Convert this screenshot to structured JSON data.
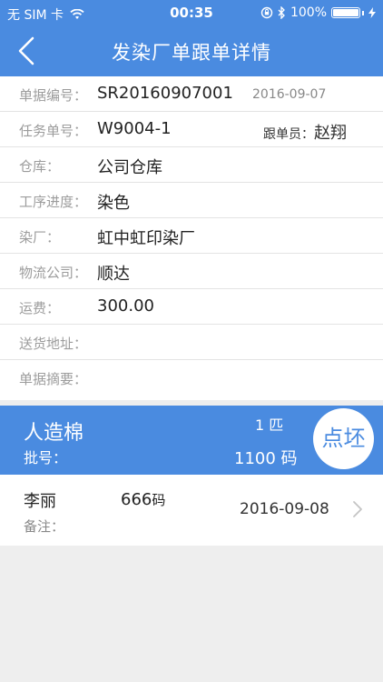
{
  "status_bar": {
    "carrier": "无 SIM 卡",
    "time": "00:35",
    "battery": "100%"
  },
  "nav": {
    "title": "发染厂单跟单详情"
  },
  "form": {
    "doc_no_label": "单据编号：",
    "doc_no_value": "SR20160907001",
    "doc_date": "2016-09-07",
    "task_no_label": "任务单号：",
    "task_no_value": "W9004-1",
    "follower_label": "跟单员：",
    "follower_name": "赵翔",
    "warehouse_label": "仓库：",
    "warehouse_value": "公司仓库",
    "process_label": "工序进度：",
    "process_value": "染色",
    "dyehouse_label": "染厂：",
    "dyehouse_value": "虹中虹印染厂",
    "logistics_label": "物流公司：",
    "logistics_value": "顺达",
    "freight_label": "运费：",
    "freight_value": "300.00",
    "address_label": "送货地址：",
    "address_value": "",
    "summary_label": "单据摘要：",
    "summary_value": ""
  },
  "product": {
    "name": "人造棉",
    "batch_label": "批号：",
    "pieces": "1 匹",
    "yards": "1100 码",
    "inspect_label": "点坯"
  },
  "record": {
    "person": "李丽",
    "qty": "666",
    "unit": "码",
    "remark_label": "备注：",
    "date": "2016-09-08"
  },
  "colors": {
    "accent": "#4a8be0",
    "background": "#eeeeee"
  }
}
